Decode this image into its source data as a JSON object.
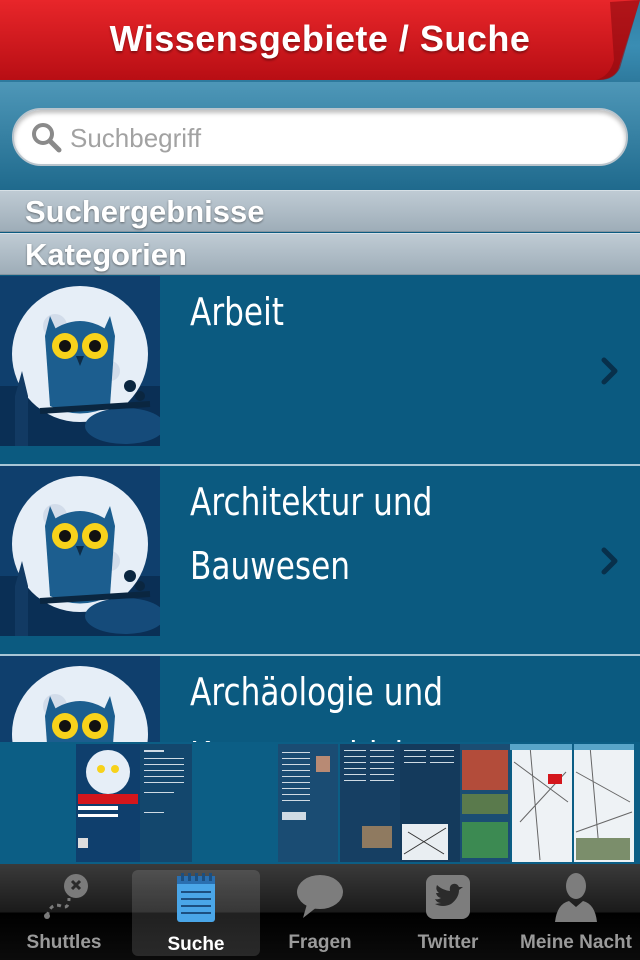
{
  "header": {
    "title": "Wissensgebiete / Suche"
  },
  "search": {
    "placeholder": "Suchbegriff",
    "value": ""
  },
  "sections": {
    "results": "Suchergebnisse",
    "categories": "Kategorien"
  },
  "categories": [
    {
      "label": "Arbeit"
    },
    {
      "label": "Architektur und\nBauwesen"
    },
    {
      "label": "Archäologie und\nKunstgeschichte"
    }
  ],
  "tabs": [
    {
      "label": "Shuttles",
      "icon": "map-route-icon",
      "active": false
    },
    {
      "label": "Suche",
      "icon": "notepad-icon",
      "active": true
    },
    {
      "label": "Fragen",
      "icon": "speech-bubble-icon",
      "active": false
    },
    {
      "label": "Twitter",
      "icon": "twitter-bird-icon",
      "active": false
    },
    {
      "label": "Meine Nacht",
      "icon": "person-icon",
      "active": false
    }
  ],
  "colors": {
    "banner_red": "#d4161c",
    "list_blue": "#0b5a80",
    "header_gray": "#b3c1cb"
  }
}
